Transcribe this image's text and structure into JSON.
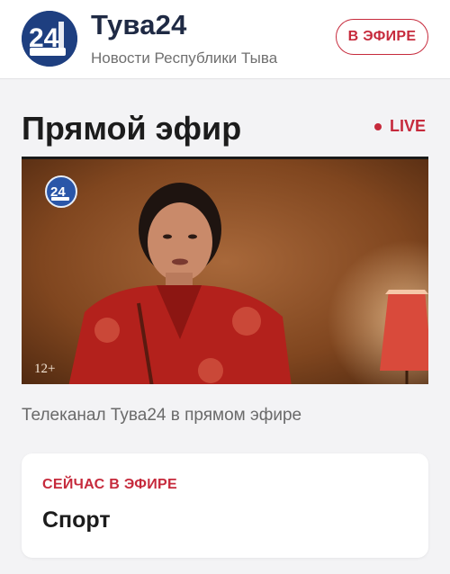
{
  "header": {
    "logo_icon": "tuva24-logo-icon",
    "title": "Тува24",
    "subtitle": "Новости Республики Тыва",
    "live_button_label": "В ЭФИРЕ"
  },
  "main": {
    "title": "Прямой эфир",
    "live_indicator": "LIVE",
    "player": {
      "channel_logo_icon": "tuva24-channel-logo-icon",
      "age_rating": "12+"
    },
    "caption": "Телеканал Тува24 в прямом эфире",
    "now_playing": {
      "label": "СЕЙЧАС В ЭФИРЕ",
      "program": "Спорт"
    }
  },
  "colors": {
    "accent": "#c62a3c",
    "brand_blue": "#1e3f80",
    "background": "#f3f3f5",
    "card": "#ffffff"
  }
}
